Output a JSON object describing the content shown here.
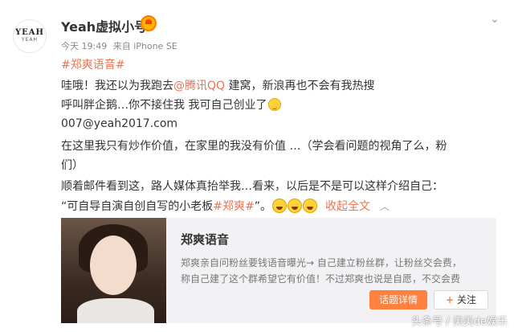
{
  "header": {
    "username": "Yeah虚拟小号",
    "avatar_logo_main": "YEAH",
    "avatar_logo_sub": "YEAH",
    "time": "今天 19:49",
    "source": "来自 iPhone SE"
  },
  "post": {
    "hashtag": "#郑爽语音#",
    "line1_pre": "哇哦！我还以为我跑去",
    "mention": "@腾讯QQ",
    "line1_post": " 建窝，新浪再也不会有我热搜",
    "line2": "呼叫胖企鹅…你不接住我 我可自己创业了",
    "line3": "007@yeah2017.com",
    "line4": "在这里我只有炒作价值，在家里的我没有价值 …（学会看问题的视角了么，粉",
    "line5": "们）",
    "line6": "顺着邮件看到这，路人媒体真抬举我…看来，以后是不是可以这样介绍自己：",
    "line7_pre": "“可自导自演自创自写的小老板",
    "line7_tag": "#郑爽#",
    "line7_post": "”。",
    "collapse_label": "收起全文"
  },
  "card": {
    "title": "郑爽语音",
    "desc1": "郑爽亲自问粉丝要钱语音曝光→ 自己建立粉丝群，让粉丝交会费，",
    "desc2": "称自己建了这个群希望它有价值！不过郑爽也说是自愿，不交会费",
    "detail_button": "话题详情",
    "follow_button": "关注"
  },
  "watermark": "头条号 / 美美de娱乐",
  "colors": {
    "accent": "#eb7350",
    "button_orange": "#ff8140",
    "card_bg": "#f2f2f5"
  },
  "icons": [
    "vip-badge-icon",
    "chevron-down-icon",
    "emoji-icon",
    "laugh-cry-icon",
    "plus-icon"
  ]
}
